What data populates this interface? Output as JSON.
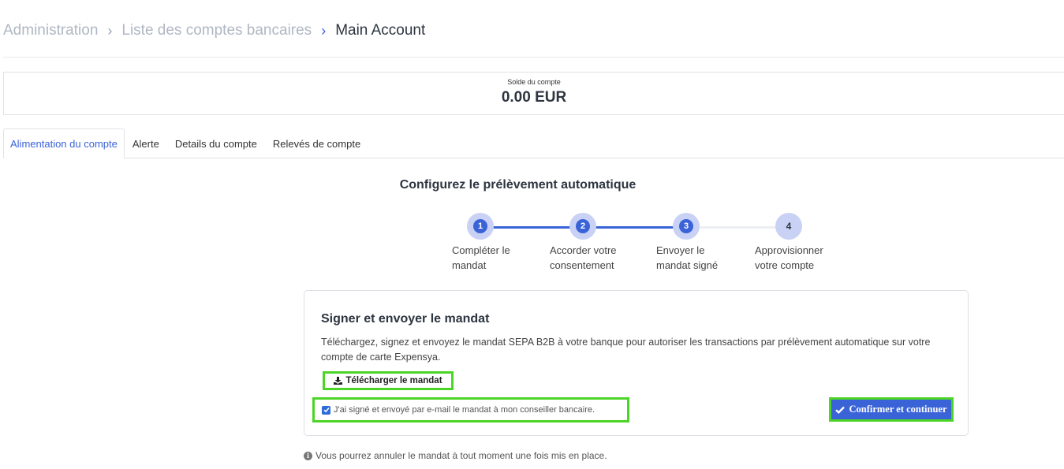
{
  "breadcrumb": {
    "items": [
      "Administration",
      "Liste des comptes bancaires"
    ],
    "current": "Main Account"
  },
  "balance": {
    "label": "Solde du compte",
    "value": "0.00 EUR"
  },
  "tabs": [
    {
      "label": "Alimentation du compte",
      "active": true
    },
    {
      "label": "Alerte",
      "active": false
    },
    {
      "label": "Details du compte",
      "active": false
    },
    {
      "label": "Relevés de compte",
      "active": false
    }
  ],
  "section_title": "Configurez le prélèvement automatique",
  "stepper": {
    "current_step": 3,
    "steps": [
      {
        "number": "1",
        "label_line1": "Compléter le",
        "label_line2": "mandat"
      },
      {
        "number": "2",
        "label_line1": "Accorder votre",
        "label_line2": "consentement"
      },
      {
        "number": "3",
        "label_line1": "Envoyer le",
        "label_line2": "mandat signé"
      },
      {
        "number": "4",
        "label_line1": "Approvisionner",
        "label_line2": "votre compte"
      }
    ]
  },
  "card": {
    "title": "Signer et envoyer le mandat",
    "text": "Téléchargez, signez et envoyez le mandat SEPA B2B à votre banque pour autoriser les transactions par prélèvement automatique sur votre compte de carte Expensya.",
    "download_label": "Télécharger le mandat",
    "checkbox_label": "J'ai signé et envoyé par e-mail le mandat à mon conseiller bancaire.",
    "checkbox_checked": true,
    "confirm_label": "Confirmer et continuer"
  },
  "note": "Vous pourrez annuler le mandat à tout moment une fois mis en place.",
  "colors": {
    "accent": "#3a63d8",
    "highlight": "#4cd526",
    "step_ring": "#c9d2f5"
  }
}
